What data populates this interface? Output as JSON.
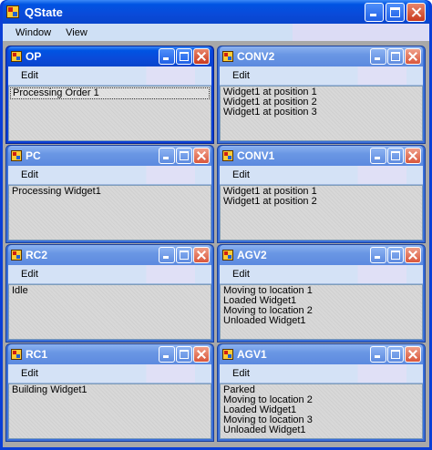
{
  "app": {
    "title": "QState",
    "icon": "app-icon"
  },
  "menu": {
    "items": [
      "Window",
      "View"
    ]
  },
  "windows": [
    {
      "title": "OP",
      "menu": "Edit",
      "items": [
        "Processing Order 1"
      ]
    },
    {
      "title": "CONV2",
      "menu": "Edit",
      "items": [
        "Widget1 at position 1",
        "Widget1 at position 2",
        "Widget1 at position 3"
      ]
    },
    {
      "title": "PC",
      "menu": "Edit",
      "items": [
        "Processing Widget1"
      ]
    },
    {
      "title": "CONV1",
      "menu": "Edit",
      "items": [
        "Widget1 at position 1",
        "Widget1 at position 2"
      ]
    },
    {
      "title": "RC2",
      "menu": "Edit",
      "items": [
        "Idle"
      ]
    },
    {
      "title": "AGV2",
      "menu": "Edit",
      "items": [
        "Moving to location 1",
        "Loaded Widget1",
        "Moving to location 2",
        "Unloaded Widget1"
      ]
    },
    {
      "title": "RC1",
      "menu": "Edit",
      "items": [
        "Building Widget1"
      ]
    },
    {
      "title": "AGV1",
      "menu": "Edit",
      "items": [
        "Parked",
        "Moving to location 2",
        "Loaded Widget1",
        "Moving to location 3",
        "Unloaded Widget1"
      ]
    }
  ],
  "active_window": "OP",
  "colors": {
    "titlebar": "#0054e3",
    "inactive_titlebar": "#6a97e4",
    "close_button": "#c93a1e",
    "mdi_background": "#a8a8a8"
  }
}
